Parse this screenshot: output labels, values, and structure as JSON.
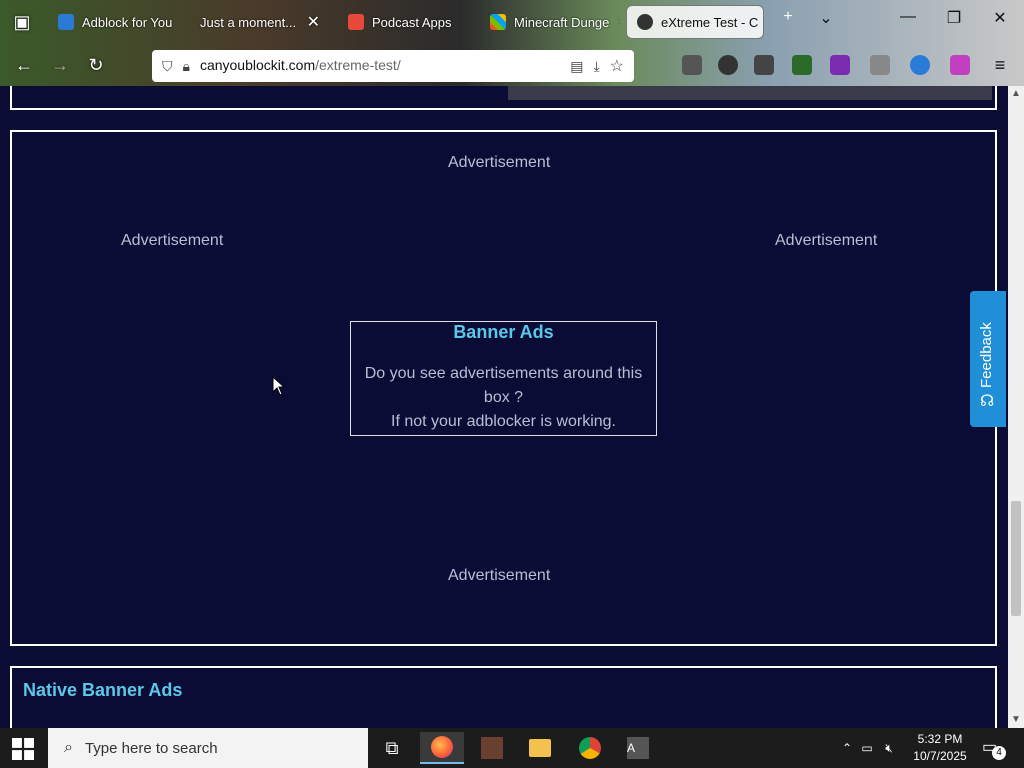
{
  "browser": {
    "tabs": [
      {
        "label": "Adblock for You",
        "active": false
      },
      {
        "label": "Just a moment...",
        "active": false
      },
      {
        "label": "Podcast Apps",
        "active": false
      },
      {
        "label": "Minecraft Dunge",
        "active": false
      },
      {
        "label": "eXtreme Test - C",
        "active": true
      }
    ],
    "url_host": "canyoublockit.com",
    "url_path": "/extreme-test/"
  },
  "page": {
    "ad_top": "Advertisement",
    "ad_left": "Advertisement",
    "ad_right": "Advertisement",
    "ad_bottom": "Advertisement",
    "banner_title": "Banner Ads",
    "banner_line1": "Do you see advertisements around this box ?",
    "banner_line2": "If not your adblocker is working.",
    "native_title": "Native Banner Ads",
    "feedback_label": "Feedback"
  },
  "taskbar": {
    "search_placeholder": "Type here to search",
    "time": "5:32 PM",
    "date": "10/7/2025",
    "notification_count": "4"
  },
  "colors": {
    "page_bg": "#0a0c36",
    "accent": "#5bc8e8",
    "feedback_bg": "#1f8fd8"
  }
}
